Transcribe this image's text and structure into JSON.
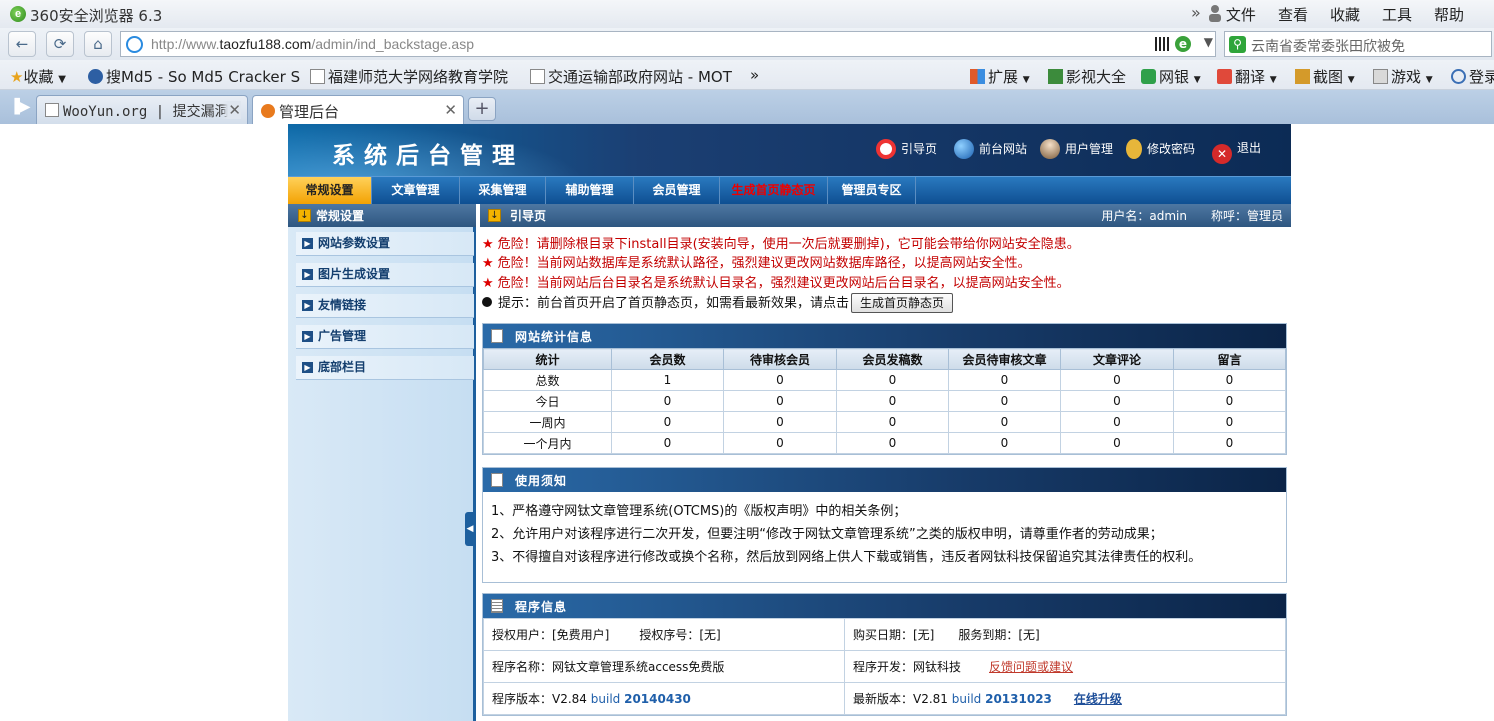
{
  "browser": {
    "title": "360安全浏览器 6.3",
    "menu": [
      "文件",
      "查看",
      "收藏",
      "工具",
      "帮助"
    ],
    "url_prefix": "http://www.",
    "url_domain": "taozfu188.com",
    "url_path": "/admin/ind_backstage.asp",
    "search_text": "云南省委常委张田欣被免",
    "favorites": [
      "收藏",
      "搜Md5 - So Md5 Cracker S",
      "福建师范大学网络教育学院",
      "交通运输部政府网站 - MOT"
    ],
    "fav_more": "»",
    "right_tools": [
      "扩展",
      "影视大全",
      "网银",
      "翻译",
      "截图",
      "游戏",
      "登录"
    ],
    "tabs": [
      {
        "label": "WooYun.org | 提交漏洞"
      },
      {
        "label": "管理后台"
      }
    ],
    "new_tab": "+"
  },
  "admin": {
    "system_title": "系统后台管理",
    "header_links": [
      "引导页",
      "前台网站",
      "用户管理",
      "修改密码",
      "退出"
    ],
    "nav": [
      "常规设置",
      "文章管理",
      "采集管理",
      "辅助管理",
      "会员管理",
      "生成首页静态页",
      "管理员专区"
    ],
    "left_head": "常规设置",
    "left_items": [
      "网站参数设置",
      "图片生成设置",
      "友情链接",
      "广告管理",
      "底部栏目"
    ],
    "right_head": "引导页",
    "user_info": "用户名：admin　　称呼：管理员",
    "warnings": [
      "危险！请删除根目录下install目录(安装向导，使用一次后就要删掉)，它可能会带给你网站安全隐患。",
      "危险！当前网站数据库是系统默认路径，强烈建议更改网站数据库路径，以提高网站安全性。",
      "危险！当前网站后台目录名是系统默认目录名，强烈建议更改网站后台目录名，以提高网站安全性。"
    ],
    "tip_text": "提示：前台首页开启了首页静态页，如需看最新效果，请点击",
    "tip_button": "生成首页静态页",
    "stats_title": "网站统计信息",
    "stats_headers": [
      "统计",
      "会员数",
      "待审核会员",
      "会员发稿数",
      "会员待审核文章",
      "文章评论",
      "留言"
    ],
    "stats_rows": [
      [
        "总数",
        "1",
        "0",
        "0",
        "0",
        "0",
        "0"
      ],
      [
        "今日",
        "0",
        "0",
        "0",
        "0",
        "0",
        "0"
      ],
      [
        "一周内",
        "0",
        "0",
        "0",
        "0",
        "0",
        "0"
      ],
      [
        "一个月内",
        "0",
        "0",
        "0",
        "0",
        "0",
        "0"
      ]
    ],
    "notice_title": "使用须知",
    "notices": [
      "1、严格遵守网钛文章管理系统(OTCMS)的《版权声明》中的相关条例；",
      "2、允许用户对该程序进行二次开发，但要注明“修改于网钛文章管理系统”之类的版权申明，请尊重作者的劳动成果；",
      "3、不得擅自对该程序进行修改或换个名称，然后放到网络上供人下载或销售，违反者网钛科技保留追究其法律责任的权利。"
    ],
    "program_title": "程序信息",
    "auth_user": "授权用户：[免费用户]",
    "auth_no": "授权序号：[无]",
    "buy_date": "购买日期：[无]",
    "service_end": "服务到期：[无]",
    "program_name": "程序名称：网钛文章管理系统access免费版",
    "developer": "程序开发：网钛科技",
    "feedback": "反馈问题或建议",
    "version_label": "程序版本：V2.84",
    "version_build": "build",
    "version_num": "20140430",
    "latest_label": "最新版本：V2.81",
    "latest_build": "build",
    "latest_num": "20131023",
    "upgrade": "在线升级"
  }
}
